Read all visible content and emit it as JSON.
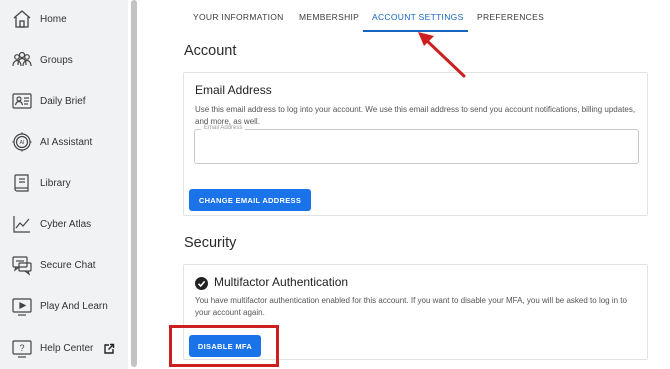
{
  "sidebar": {
    "items": [
      {
        "label": "Home",
        "icon": "home-icon"
      },
      {
        "label": "Groups",
        "icon": "groups-icon"
      },
      {
        "label": "Daily Brief",
        "icon": "daily-brief-icon"
      },
      {
        "label": "AI Assistant",
        "icon": "ai-assistant-icon"
      },
      {
        "label": "Library",
        "icon": "library-icon"
      },
      {
        "label": "Cyber Atlas",
        "icon": "cyber-atlas-icon"
      },
      {
        "label": "Secure Chat",
        "icon": "secure-chat-icon"
      },
      {
        "label": "Play And Learn",
        "icon": "play-and-learn-icon"
      },
      {
        "label": "Help Center",
        "icon": "help-center-icon"
      }
    ]
  },
  "tabs": [
    {
      "label": "YOUR INFORMATION",
      "active": false
    },
    {
      "label": "MEMBERSHIP",
      "active": false
    },
    {
      "label": "ACCOUNT SETTINGS",
      "active": true
    },
    {
      "label": "PREFERENCES",
      "active": false
    }
  ],
  "account": {
    "title": "Account",
    "email": {
      "heading": "Email Address",
      "description": "Use this email address to log into your account. We use this email address to send you account notifications, billing updates, and more, as well.",
      "field_label": "Email Address",
      "field_value": "",
      "button_label": "CHANGE EMAIL ADDRESS"
    }
  },
  "security": {
    "title": "Security",
    "mfa": {
      "heading": "Multifactor Authentication",
      "description": "You have multifactor authentication enabled for this account. If you want to disable your MFA, you will be asked to log in to your account again.",
      "button_label": "DISABLE MFA"
    }
  },
  "colors": {
    "accent": "#1565c0",
    "button": "#1a73e8",
    "annotation": "#cc1f1f",
    "sidebar_bg": "#f1f2f4"
  }
}
